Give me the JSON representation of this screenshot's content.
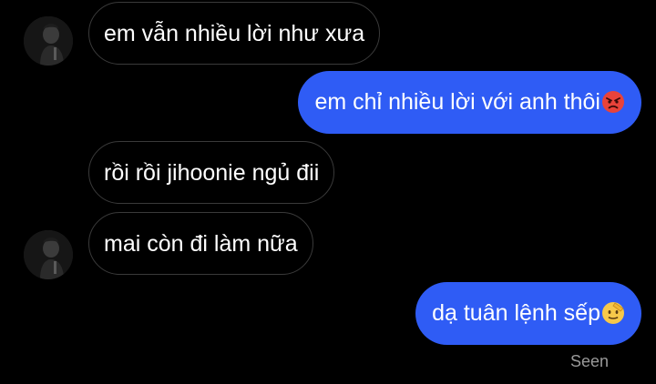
{
  "messages": [
    {
      "side": "in",
      "text": "em vẫn nhiều lời như xưa"
    },
    {
      "side": "out",
      "text": "em chỉ nhiều lời với anh thôi",
      "emoji": "angry-face"
    },
    {
      "side": "in",
      "text": "rồi rồi jihoonie ngủ đii"
    },
    {
      "side": "in",
      "text": "mai còn đi làm nữa"
    },
    {
      "side": "out",
      "text": "dạ tuân lệnh sếp",
      "emoji": "saluting-face"
    }
  ],
  "status": {
    "seen": "Seen"
  },
  "icons": {
    "avatar": "contact-avatar",
    "emoji_1": "angry-face-emoji",
    "emoji_2": "saluting-face-emoji"
  },
  "colors": {
    "background": "#000000",
    "outgoing_bubble": "#2f5cf5",
    "incoming_border": "#3a3a3a",
    "text": "#ffffff",
    "seen_text": "#9a9a9a"
  }
}
